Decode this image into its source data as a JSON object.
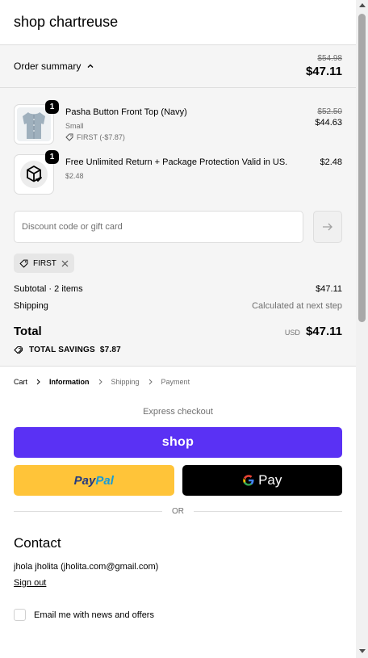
{
  "header": {
    "shop_name": "shop chartreuse"
  },
  "summary": {
    "toggle_label": "Order summary",
    "original_total": "$54.98",
    "total": "$47.11",
    "items": [
      {
        "title": "Pasha Button Front Top (Navy)",
        "variant": "Small",
        "discount": "FIRST (-$7.87)",
        "quantity": "1",
        "original_price": "$52.50",
        "price": "$44.63",
        "icon": "blouse-photo"
      },
      {
        "title": "Free Unlimited Return + Package Protection Valid in US.",
        "variant": "$2.48",
        "quantity": "1",
        "price": "$2.48",
        "icon": "package-check-icon"
      }
    ],
    "discount_placeholder": "Discount code or gift card",
    "applied_code": "FIRST",
    "subtotal_label": "Subtotal · 2 items",
    "subtotal_value": "$47.11",
    "shipping_label": "Shipping",
    "shipping_value": "Calculated at next step",
    "total_label": "Total",
    "currency": "USD",
    "total_value": "$47.11",
    "savings_label": "TOTAL SAVINGS",
    "savings_value": "$7.87"
  },
  "breadcrumbs": [
    "Cart",
    "Information",
    "Shipping",
    "Payment"
  ],
  "checkout": {
    "express_label": "Express checkout",
    "shop_pay_label": "shop",
    "paypal_part1": "Pay",
    "paypal_part2": "Pal",
    "gpay_g": "G",
    "gpay_label": "Pay",
    "or_label": "OR",
    "contact_title": "Contact",
    "contact_info": "jhola jholita (jholita.com@gmail.com)",
    "sign_out": "Sign out",
    "newsletter_label": "Email me with news and offers"
  },
  "colors": {
    "shop_pay": "#5a31f4",
    "paypal": "#ffc439",
    "gpay": "#000000"
  }
}
